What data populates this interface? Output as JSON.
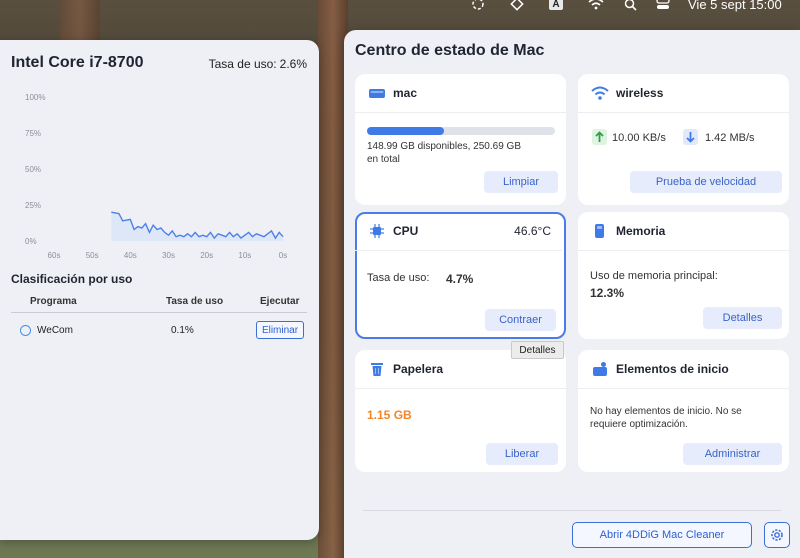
{
  "menubar": {
    "date_time": "Vie 5 sept 15:00",
    "input_letter": "A"
  },
  "left": {
    "title": "Intel Core i7-8700",
    "rate_label": "Tasa de uso:",
    "rate_value": "2.6%",
    "section_title": "Clasificación por uso",
    "table": {
      "headers": [
        "Programa",
        "Tasa de uso",
        "Ejecutar"
      ],
      "rows": [
        {
          "name": "WeCom",
          "rate": "0.1%",
          "action": "Eliminar"
        }
      ]
    }
  },
  "chart_data": {
    "type": "line",
    "y_ticks": [
      "100%",
      "75%",
      "50%",
      "25%",
      "0%"
    ],
    "x_ticks": [
      "60s",
      "50s",
      "40s",
      "30s",
      "20s",
      "10s",
      "0s"
    ],
    "ylim": [
      0,
      100
    ],
    "xlim": [
      60,
      0
    ],
    "x": [
      45,
      43,
      42,
      40,
      39,
      38,
      37,
      36,
      35,
      34,
      33,
      32,
      31,
      30,
      29,
      28,
      27,
      26,
      25,
      24,
      23,
      22,
      21,
      20,
      19,
      18,
      17,
      16,
      15,
      14,
      13,
      12,
      11,
      10,
      9,
      8,
      7,
      6,
      5,
      4,
      3,
      2,
      1,
      0
    ],
    "values": [
      20,
      19,
      14,
      15,
      8,
      10,
      9,
      12,
      6,
      11,
      8,
      9,
      6,
      4,
      7,
      3,
      4,
      3,
      5,
      3,
      6,
      3,
      4,
      3,
      6,
      2,
      5,
      4,
      3,
      6,
      3,
      5,
      2,
      4,
      6,
      3,
      5,
      4,
      3,
      5,
      7,
      2,
      6,
      3
    ],
    "color": "#4f7fe8"
  },
  "right": {
    "title": "Centro de estado de Mac",
    "cards": {
      "disk": {
        "title": "mac",
        "used_fraction": 0.41,
        "line1": "148.99 GB disponibles, 250.69 GB",
        "line2": "en total",
        "button": "Limpiar"
      },
      "network": {
        "title": "wireless",
        "upload": "10.00 KB/s",
        "download": "1.42 MB/s",
        "button": "Prueba de velocidad"
      },
      "cpu": {
        "title": "CPU",
        "temp": "46.6°C",
        "rate_label": "Tasa de uso:",
        "rate_value": "4.7%",
        "button": "Contraer"
      },
      "memory": {
        "title": "Memoria",
        "label": "Uso de memoria principal:",
        "value": "12.3%",
        "button": "Detalles"
      },
      "trash": {
        "title": "Papelera",
        "value": "1.15 GB",
        "button": "Liberar"
      },
      "startup": {
        "title": "Elementos de inicio",
        "line1": "No hay elementos de inicio. No se",
        "line2": "requiere optimización.",
        "button": "Administrar"
      }
    },
    "tooltip": "Detalles",
    "cleaner_button": "Abrir 4DDiG Mac Cleaner"
  },
  "colors": {
    "accent": "#3a6fd8",
    "orange": "#f0862b",
    "bar": "#3f7be6"
  }
}
